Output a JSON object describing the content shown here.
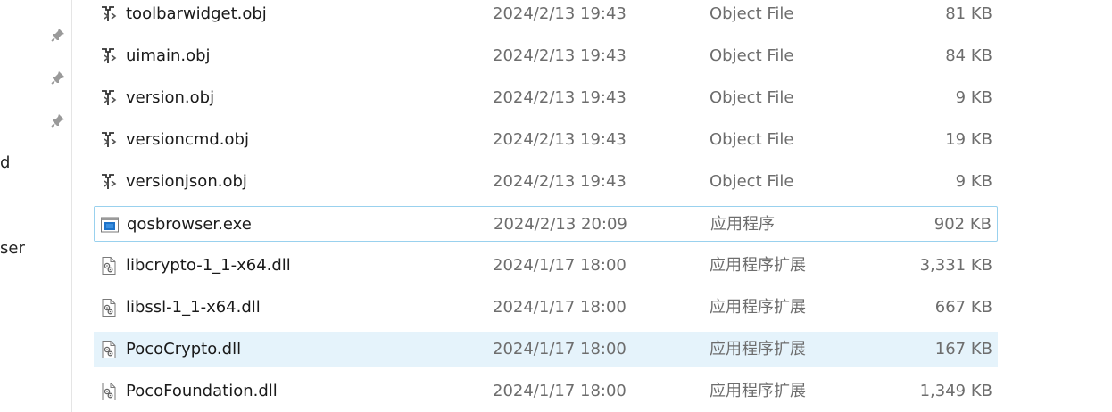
{
  "nav_pane": {
    "items": [
      {
        "label": "d",
        "truncated": true
      },
      {
        "label": "ser",
        "truncated": true
      }
    ],
    "pins": [
      {
        "icon": "pin-icon"
      },
      {
        "icon": "pin-icon"
      },
      {
        "icon": "pin-icon"
      }
    ]
  },
  "files": [
    {
      "name": "toolbarwidget.obj",
      "date": "2024/2/13 19:43",
      "type": "Object File",
      "size": "81 KB",
      "icon": "object-file-icon"
    },
    {
      "name": "uimain.obj",
      "date": "2024/2/13 19:43",
      "type": "Object File",
      "size": "84 KB",
      "icon": "object-file-icon"
    },
    {
      "name": "version.obj",
      "date": "2024/2/13 19:43",
      "type": "Object File",
      "size": "9 KB",
      "icon": "object-file-icon"
    },
    {
      "name": "versioncmd.obj",
      "date": "2024/2/13 19:43",
      "type": "Object File",
      "size": "19 KB",
      "icon": "object-file-icon"
    },
    {
      "name": "versionjson.obj",
      "date": "2024/2/13 19:43",
      "type": "Object File",
      "size": "9 KB",
      "icon": "object-file-icon"
    },
    {
      "name": "qosbrowser.exe",
      "date": "2024/2/13 20:09",
      "type": "应用程序",
      "size": "902 KB",
      "icon": "application-icon",
      "state": "focused"
    },
    {
      "name": "libcrypto-1_1-x64.dll",
      "date": "2024/1/17 18:00",
      "type": "应用程序扩展",
      "size": "3,331 KB",
      "icon": "dll-file-icon"
    },
    {
      "name": "libssl-1_1-x64.dll",
      "date": "2024/1/17 18:00",
      "type": "应用程序扩展",
      "size": "667 KB",
      "icon": "dll-file-icon"
    },
    {
      "name": "PocoCrypto.dll",
      "date": "2024/1/17 18:00",
      "type": "应用程序扩展",
      "size": "167 KB",
      "icon": "dll-file-icon",
      "state": "selected"
    },
    {
      "name": "PocoFoundation.dll",
      "date": "2024/1/17 18:00",
      "type": "应用程序扩展",
      "size": "1,349 KB",
      "icon": "dll-file-icon"
    }
  ],
  "colors": {
    "selection_bg": "#e5f3fb",
    "focus_border": "#99d1ee",
    "secondary_text": "#6d6d6d",
    "primary_text": "#1a1a1a"
  }
}
